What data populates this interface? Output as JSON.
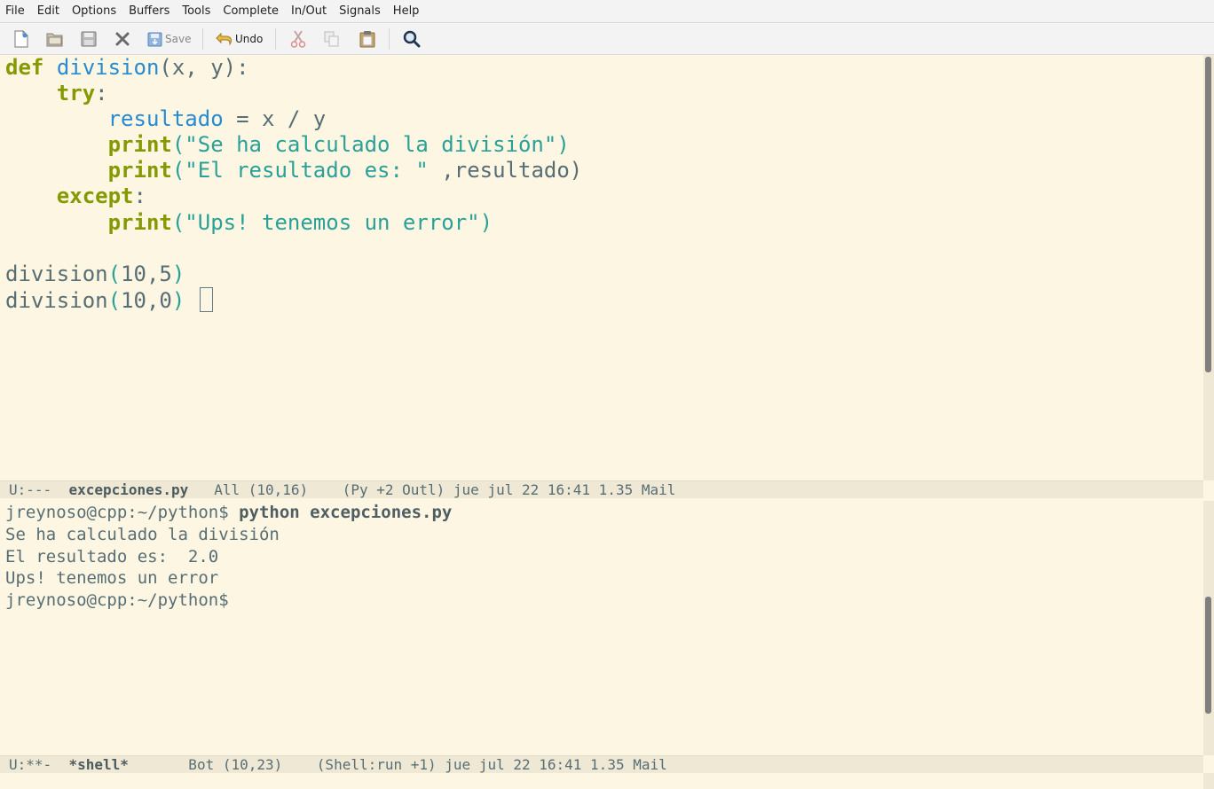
{
  "menu": [
    "File",
    "Edit",
    "Options",
    "Buffers",
    "Tools",
    "Complete",
    "In/Out",
    "Signals",
    "Help"
  ],
  "toolbar": {
    "new_icon": "new-file-icon",
    "open_icon": "open-folder-icon",
    "save_icon_disk": "disk-icon",
    "close_icon": "close-x-icon",
    "save_label": "Save",
    "undo_label": "Undo",
    "cut_icon": "scissors-icon",
    "copy_icon": "copy-icon",
    "paste_icon": "clipboard-icon",
    "search_icon": "magnifier-icon"
  },
  "editor": {
    "lines": [
      [
        {
          "t": "def",
          "c": "kw"
        },
        {
          "t": " ",
          "c": "txt"
        },
        {
          "t": "division",
          "c": "fn"
        },
        {
          "t": "(x, y):",
          "c": "txt"
        }
      ],
      [
        {
          "t": "    ",
          "c": "txt"
        },
        {
          "t": "try",
          "c": "kw"
        },
        {
          "t": ":",
          "c": "txt"
        }
      ],
      [
        {
          "t": "        ",
          "c": "txt"
        },
        {
          "t": "resultado",
          "c": "var"
        },
        {
          "t": " = x / y",
          "c": "txt"
        }
      ],
      [
        {
          "t": "        ",
          "c": "txt"
        },
        {
          "t": "print",
          "c": "kw"
        },
        {
          "t": "(",
          "c": "paren"
        },
        {
          "t": "\"Se ha calculado la división\"",
          "c": "str"
        },
        {
          "t": ")",
          "c": "paren"
        }
      ],
      [
        {
          "t": "        ",
          "c": "txt"
        },
        {
          "t": "print",
          "c": "kw"
        },
        {
          "t": "(",
          "c": "paren"
        },
        {
          "t": "\"El resultado es: \"",
          "c": "str"
        },
        {
          "t": " ,resultado)",
          "c": "txt"
        }
      ],
      [
        {
          "t": "    ",
          "c": "txt"
        },
        {
          "t": "except",
          "c": "kw"
        },
        {
          "t": ":",
          "c": "txt"
        }
      ],
      [
        {
          "t": "        ",
          "c": "txt"
        },
        {
          "t": "print",
          "c": "kw"
        },
        {
          "t": "(",
          "c": "paren"
        },
        {
          "t": "\"Ups! tenemos un error\"",
          "c": "str"
        },
        {
          "t": ")",
          "c": "paren"
        }
      ],
      [],
      [
        {
          "t": "division",
          "c": "txt"
        },
        {
          "t": "(",
          "c": "paren"
        },
        {
          "t": "10,5",
          "c": "txt"
        },
        {
          "t": ")",
          "c": "paren"
        }
      ],
      [
        {
          "t": "division",
          "c": "txt"
        },
        {
          "t": "(",
          "c": "paren"
        },
        {
          "t": "10,0",
          "c": "txt"
        },
        {
          "t": ")",
          "c": "paren"
        },
        {
          "t": " ",
          "c": "txt"
        }
      ]
    ]
  },
  "modeline_editor": {
    "status": "U:---  ",
    "buffer": "excepciones.py",
    "rest": "   All (10,16)    (Py +2 Outl) jue jul 22 16:41 1.35 Mail"
  },
  "shell": {
    "prompt": "jreynoso@cpp:~/python$ ",
    "command": "python excepciones.py",
    "output": [
      "Se ha calculado la división",
      "El resultado es:  2.0",
      "Ups! tenemos un error"
    ],
    "final_prompt": "jreynoso@cpp:~/python$"
  },
  "modeline_shell": {
    "status": "U:**-  ",
    "buffer": "*shell*",
    "rest": "       Bot (10,23)    (Shell:run +1) jue jul 22 16:41 1.35 Mail"
  }
}
